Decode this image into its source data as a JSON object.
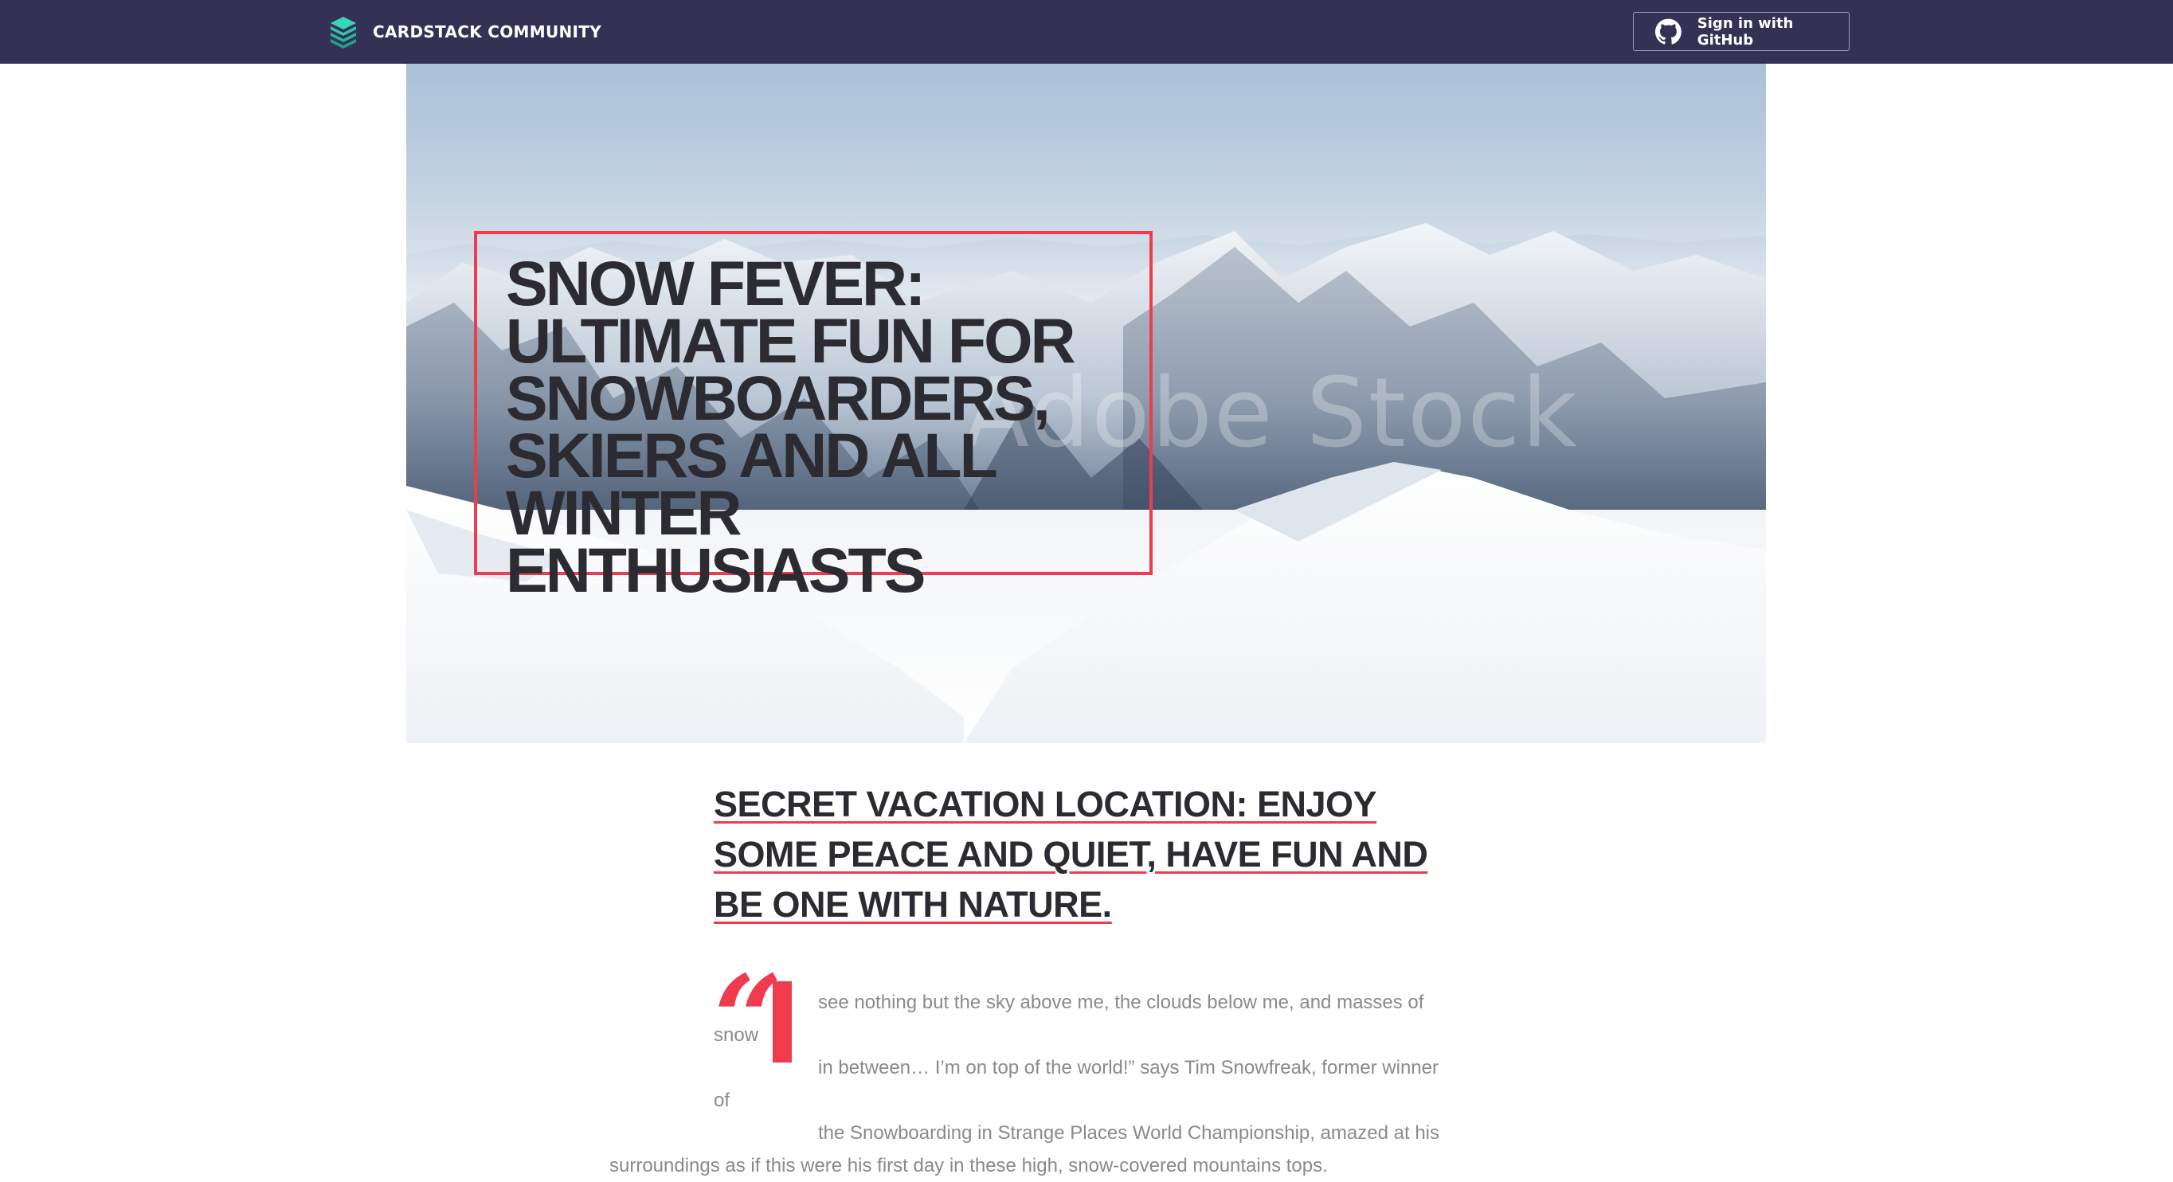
{
  "header": {
    "brand_name": "CARDSTACK COMMUNITY",
    "brand_icon": "cardstack-layers-icon",
    "github_button_label": "Sign in with GitHub",
    "github_icon": "github-icon",
    "background_color": "#343155"
  },
  "hero": {
    "title": "SNOW FEVER: ULTIMATE FUN FOR SNOWBOARDERS, SKIERS AND ALL WINTER ENTHUSIASTS",
    "watermark": "Adobe Stock",
    "border_color": "#f03a4e"
  },
  "article": {
    "subheading": "SECRET VACATION LOCATION: ENJOY SOME PEACE AND QUIET, HAVE FUN AND BE ONE WITH NATURE.",
    "quote_mark": "“",
    "dropcap": "I",
    "quote_lines": [
      "see nothing but the sky above me, the clouds below me, and masses of snow",
      "in between… I’m on top of the world!” says Tim Snowfreak, former winner of",
      "the Snowboarding in Strange Places World Championship, amazed at his",
      "surroundings as if this were his first day in these high, snow-covered mountains tops."
    ],
    "accent_color": "#f03a4e"
  }
}
